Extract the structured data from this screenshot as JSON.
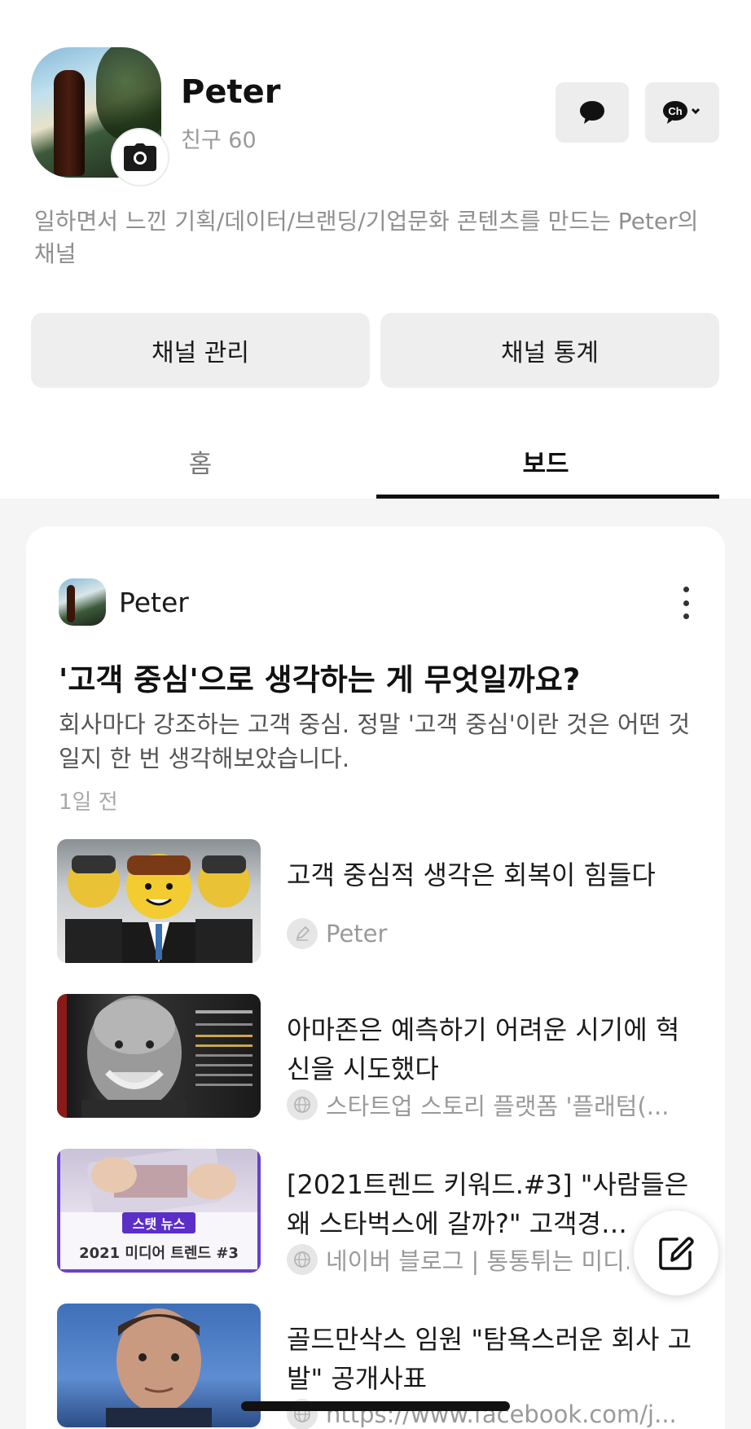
{
  "profile": {
    "name": "Peter",
    "friends": "친구 60",
    "description": "일하면서 느낀 기획/데이터/브랜딩/기업문화 콘텐츠를 만드는 Peter의 채널"
  },
  "actions": {
    "manage": "채널 관리",
    "stats": "채널 통계"
  },
  "tabs": {
    "home": "홈",
    "board": "보드",
    "active": "board"
  },
  "post": {
    "author": "Peter",
    "title": "'고객 중심'으로 생각하는 게 무엇일까요?",
    "body": "회사마다 강조하는 고객 중심. 정말 '고객 중심'이란 것은 어떤 것일지 한 번 생각해보았습니다.",
    "time": "1일 전",
    "links": [
      {
        "title": "고객 중심적 생각은 회복이 힘들다",
        "source": "Peter",
        "source_icon": "pen-icon"
      },
      {
        "title": "아마존은 예측하기 어려운 시기에 혁신을 시도했다",
        "source": "스타트업 스토리 플랫폼 '플래텀(...",
        "source_icon": "globe-icon"
      },
      {
        "title": "[2021트렌드 키워드.#3] \"사람들은 왜 스타벅스에 갈까?\" 고객경…",
        "source": "네이버 블로그 | 통통튀는 미디…",
        "source_icon": "globe-icon",
        "thumb_badge": "스탯 뉴스",
        "thumb_caption": "2021 미디어 트렌드 #3"
      },
      {
        "title": "골드만삭스 임원 \"탐욕스러운 회사 고발\" 공개사표",
        "source": "https://www.facebook.com/j...",
        "source_icon": "globe-icon"
      }
    ]
  },
  "colors": {
    "tab_underline": "#111111",
    "thumb_badge": "#5b2fc7"
  }
}
